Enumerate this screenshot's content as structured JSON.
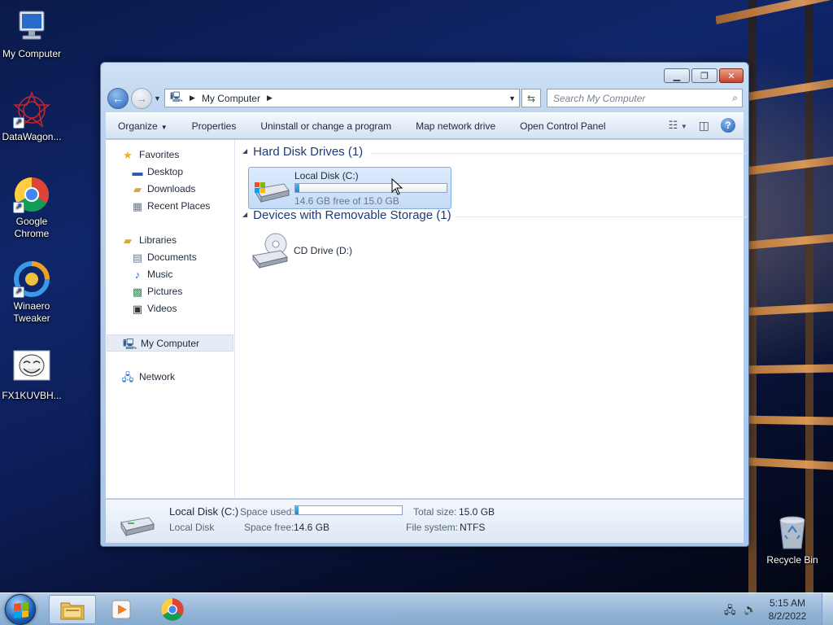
{
  "desktop": {
    "icons": [
      {
        "label": "My Computer"
      },
      {
        "label": "DataWagon..."
      },
      {
        "label": "Google Chrome"
      },
      {
        "label": "Winaero Tweaker"
      },
      {
        "label": "FX1KUVBH..."
      },
      {
        "label": "Recycle Bin"
      }
    ]
  },
  "window": {
    "address": {
      "location": "My Computer"
    },
    "search": {
      "placeholder": "Search My Computer"
    },
    "toolbar": {
      "organize": "Organize",
      "properties": "Properties",
      "uninstall": "Uninstall or change a program",
      "map_drive": "Map network drive",
      "control_panel": "Open Control Panel"
    },
    "nav": {
      "favorites": "Favorites",
      "desktop": "Desktop",
      "downloads": "Downloads",
      "recent": "Recent Places",
      "libraries": "Libraries",
      "documents": "Documents",
      "music": "Music",
      "pictures": "Pictures",
      "videos": "Videos",
      "computer": "My Computer",
      "network": "Network"
    },
    "groups": {
      "hdd": "Hard Disk Drives (1)",
      "removable": "Devices with Removable Storage (1)"
    },
    "drives": {
      "c": {
        "name": "Local Disk (C:)",
        "free_text": "14.6 GB free of 15.0 GB",
        "used_fraction": 0.027
      },
      "d": {
        "name": "CD Drive (D:)"
      }
    },
    "details": {
      "name": "Local Disk (C:)",
      "type": "Local Disk",
      "space_used_label": "Space used:",
      "space_used_fraction": 0.027,
      "space_free_label": "Space free:",
      "space_free_value": "14.6 GB",
      "total_size_label": "Total size:",
      "total_size_value": "15.0 GB",
      "fs_label": "File system:",
      "fs_value": "NTFS"
    }
  },
  "taskbar": {
    "clock_time": "5:15 AM",
    "clock_date": "8/2/2022"
  },
  "colors": {
    "accent": "#1e85d0",
    "header_text": "#1e3a78"
  }
}
